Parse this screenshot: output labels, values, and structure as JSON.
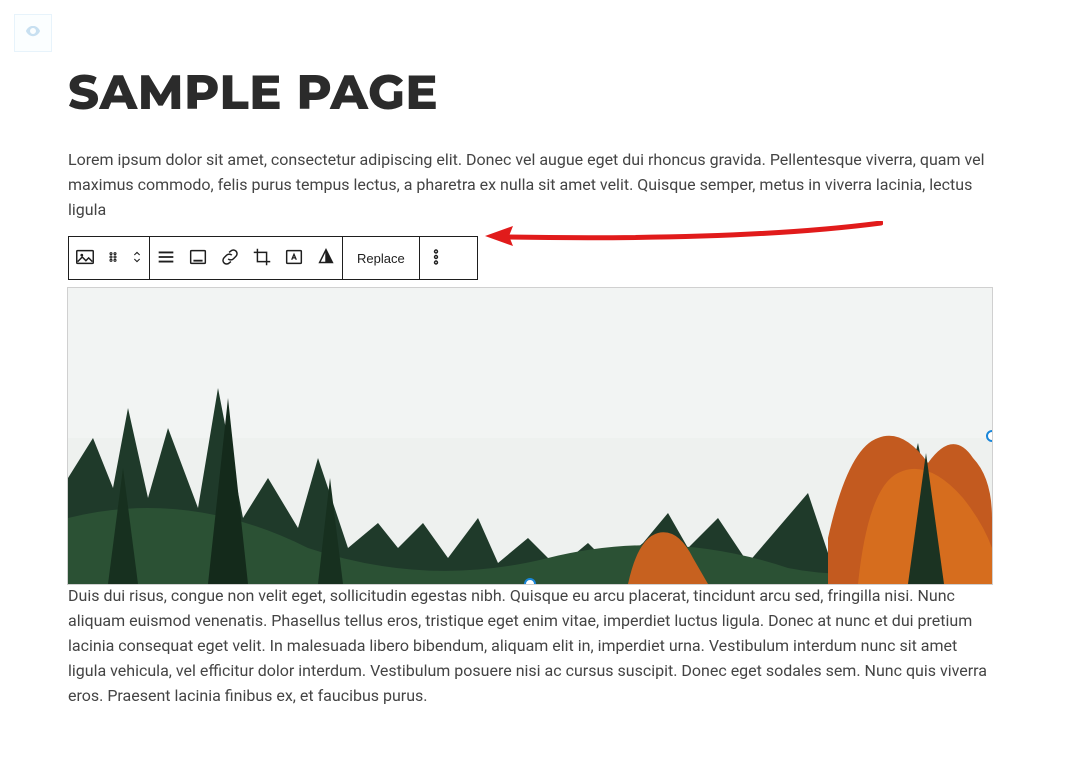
{
  "page": {
    "title": "SAMPLE PAGE",
    "paragraph_top": "Lorem ipsum dolor sit amet, consectetur adipiscing elit. Donec vel augue eget dui rhoncus gravida. Pellentesque viverra, quam vel maximus commodo, felis purus tempus lectus, a pharetra ex nulla sit amet velit. Quisque semper, metus in viverra lacinia, lectus ligula",
    "paragraph_bottom": "Duis dui risus, congue non velit eget, sollicitudin egestas nibh. Quisque eu arcu placerat, tincidunt arcu sed, fringilla nisi. Nunc aliquam euismod venenatis. Phasellus tellus eros, tristique eget enim vitae, imperdiet luctus ligula. Donec at nunc et dui pretium lacinia consequat eget velit. In malesuada libero bibendum, aliquam elit in, imperdiet urna. Vestibulum interdum nunc sit amet ligula vehicula, vel efficitur dolor interdum. Vestibulum posuere nisi ac cursus suscipit. Donec eget sodales sem. Nunc quis viverra eros. Praesent lacinia finibus ex, et faucibus purus."
  },
  "toolbar": {
    "block_type_icon": "image-icon",
    "drag_icon": "drag-icon",
    "move_icon": "move-updown-icon",
    "align_icon": "align-icon",
    "caption_icon": "caption-icon",
    "link_icon": "link-icon",
    "crop_icon": "crop-icon",
    "text_overlay_icon": "text-overlay-icon",
    "duotone_icon": "duotone-icon",
    "replace_label": "Replace",
    "more_icon": "more-vertical-icon"
  },
  "annotation": {
    "arrow_color": "#e11b1b"
  }
}
